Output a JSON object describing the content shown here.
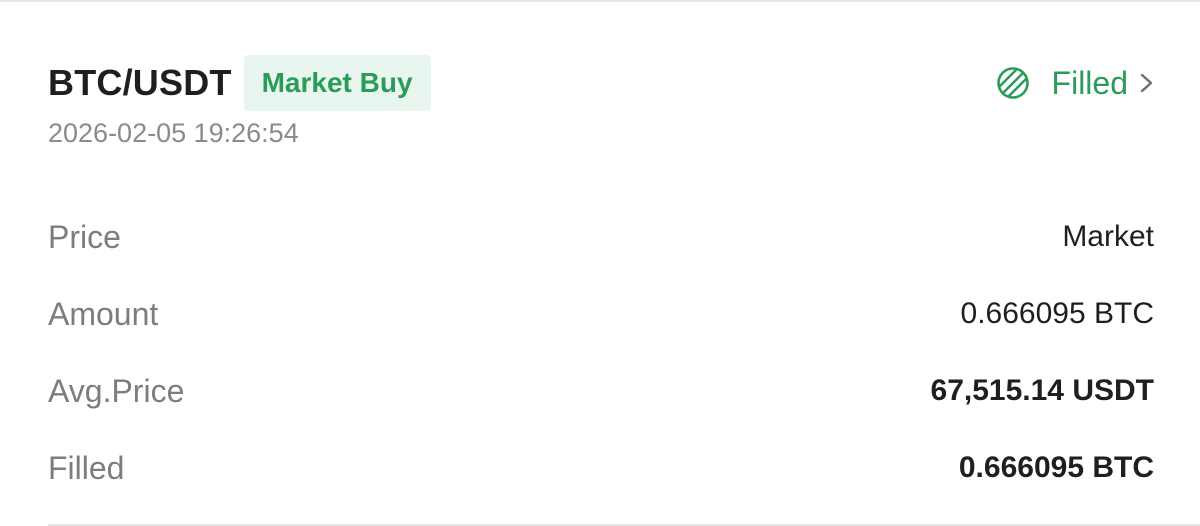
{
  "order": {
    "pair": "BTC/USDT",
    "badge": "Market Buy",
    "status": "Filled",
    "timestamp": "2026-02-05 19:26:54",
    "status_icon": "striped-circle-icon",
    "chevron_icon": "chevron-right-icon",
    "colors": {
      "accent": "#2a9b58",
      "badge_background": "#e9f6ef",
      "muted_text": "#8b8b8b",
      "primary_text": "#1f1f1f"
    },
    "details": [
      {
        "label": "Price",
        "value": "Market"
      },
      {
        "label": "Amount",
        "value": "0.666095 BTC"
      },
      {
        "label": "Avg.Price",
        "value": "67,515.14 USDT"
      },
      {
        "label": "Filled",
        "value": "0.666095 BTC"
      }
    ]
  }
}
